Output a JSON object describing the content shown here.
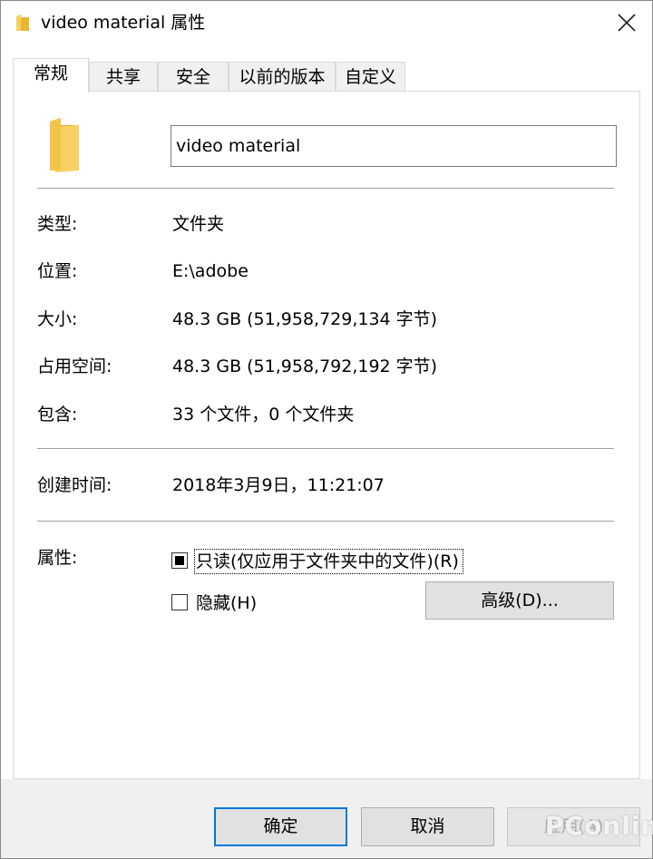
{
  "window": {
    "title": "video material 属性",
    "close_icon": "close-icon",
    "folder_icon": "folder-icon"
  },
  "tabs": [
    {
      "label": "常规",
      "active": true
    },
    {
      "label": "共享",
      "active": false
    },
    {
      "label": "安全",
      "active": false
    },
    {
      "label": "以前的版本",
      "active": false
    },
    {
      "label": "自定义",
      "active": false
    }
  ],
  "general": {
    "name_value": "video material",
    "rows": [
      {
        "label": "类型:",
        "value": "文件夹"
      },
      {
        "label": "位置:",
        "value": "E:\\adobe"
      },
      {
        "label": "大小:",
        "value": "48.3 GB (51,958,729,134 字节)"
      },
      {
        "label": "占用空间:",
        "value": "48.3 GB (51,958,792,192 字节)"
      },
      {
        "label": "包含:",
        "value": "33 个文件，0 个文件夹"
      }
    ],
    "created": {
      "label": "创建时间:",
      "value": "2018年3月9日，11:21:07"
    },
    "attributes": {
      "label": "属性:",
      "readonly": {
        "label": "只读(仅应用于文件夹中的文件)(R)",
        "state": "indeterminate"
      },
      "hidden": {
        "label": "隐藏(H)",
        "checked": false
      },
      "advanced_button": "高级(D)..."
    }
  },
  "buttons": {
    "ok": "确定",
    "cancel": "取消",
    "apply": "应用(A)"
  },
  "colors": {
    "folder": "#f5c84a",
    "default_button_border": "#0078d7"
  },
  "watermark": "PConline"
}
